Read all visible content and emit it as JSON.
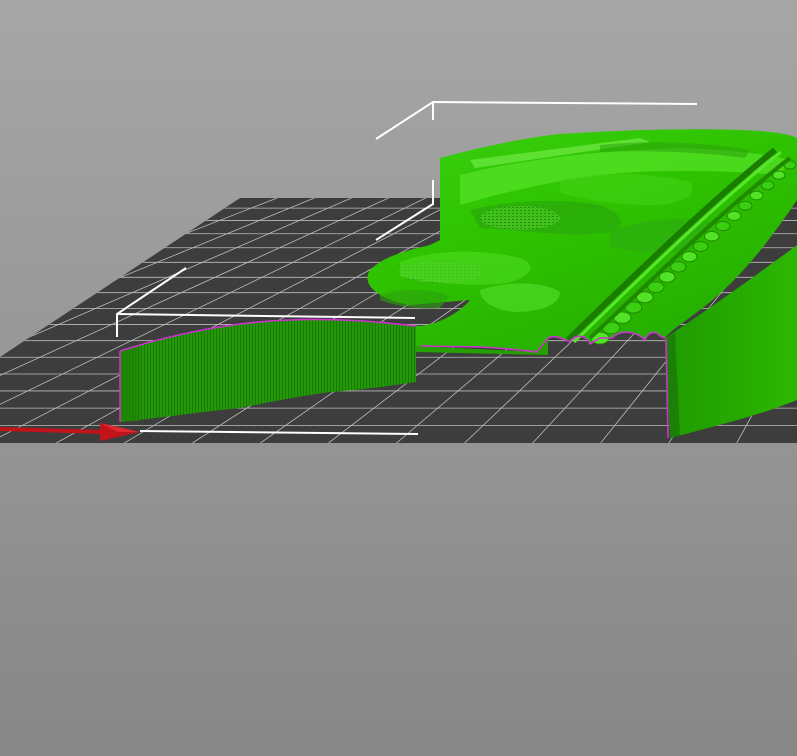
{
  "scene": {
    "background_top": "#a5a5a5",
    "background_bottom": "#8a8a8a",
    "bed_color": "#3d3d3d",
    "bed_grid_color": "#c8c8c8",
    "model_color": "#33cc00",
    "model_dark": "#1f8a00",
    "model_light": "#5fe83a",
    "outline_color": "#cc33cc",
    "bounding_box_color": "#ffffff",
    "x_axis_color": "#c0141a",
    "axis_icon": "x-axis-arrow-icon"
  }
}
